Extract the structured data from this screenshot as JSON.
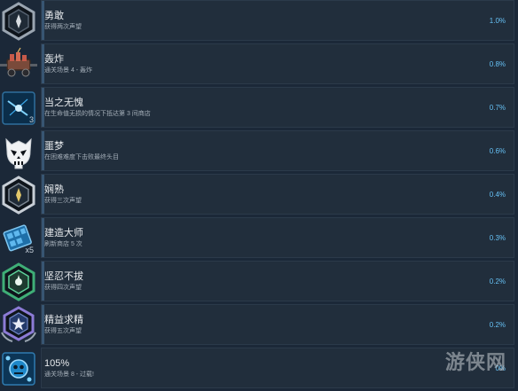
{
  "achievements": [
    {
      "icon": "hexagon-badge-gray-icon",
      "title": "勇敢",
      "desc": "获得两次声望",
      "pct": "1.0%",
      "progress": 0.01
    },
    {
      "icon": "dynamite-cart-icon",
      "title": "轰炸",
      "desc": "通关场景 4 - 轰炸",
      "pct": "0.8%",
      "progress": 0.008
    },
    {
      "icon": "blue-spark-icon",
      "title": "当之无愧",
      "desc": "在生命值无损的情况下抵达第 3 间商店",
      "pct": "0.7%",
      "progress": 0.007,
      "badge": "3"
    },
    {
      "icon": "skull-icon",
      "title": "噩梦",
      "desc": "在困难难度下击败最终头目",
      "pct": "0.6%",
      "progress": 0.006
    },
    {
      "icon": "hexagon-badge-silver-icon",
      "title": "娴熟",
      "desc": "获得三次声望",
      "pct": "0.4%",
      "progress": 0.004
    },
    {
      "icon": "blue-blocks-icon",
      "title": "建造大师",
      "desc": "刷新商店 5 次",
      "pct": "0.3%",
      "progress": 0.003,
      "badge": "x5"
    },
    {
      "icon": "hexagon-badge-green-icon",
      "title": "坚忍不拔",
      "desc": "获得四次声望",
      "pct": "0.2%",
      "progress": 0.002
    },
    {
      "icon": "hexagon-badge-star-icon",
      "title": "精益求精",
      "desc": "获得五次声望",
      "pct": "0.2%",
      "progress": 0.002
    },
    {
      "icon": "blue-robot-icon",
      "title": "105%",
      "desc": "通关场景 8 - 过载!",
      "pct": "0%",
      "progress": 0.0
    }
  ],
  "watermark": "游侠网"
}
